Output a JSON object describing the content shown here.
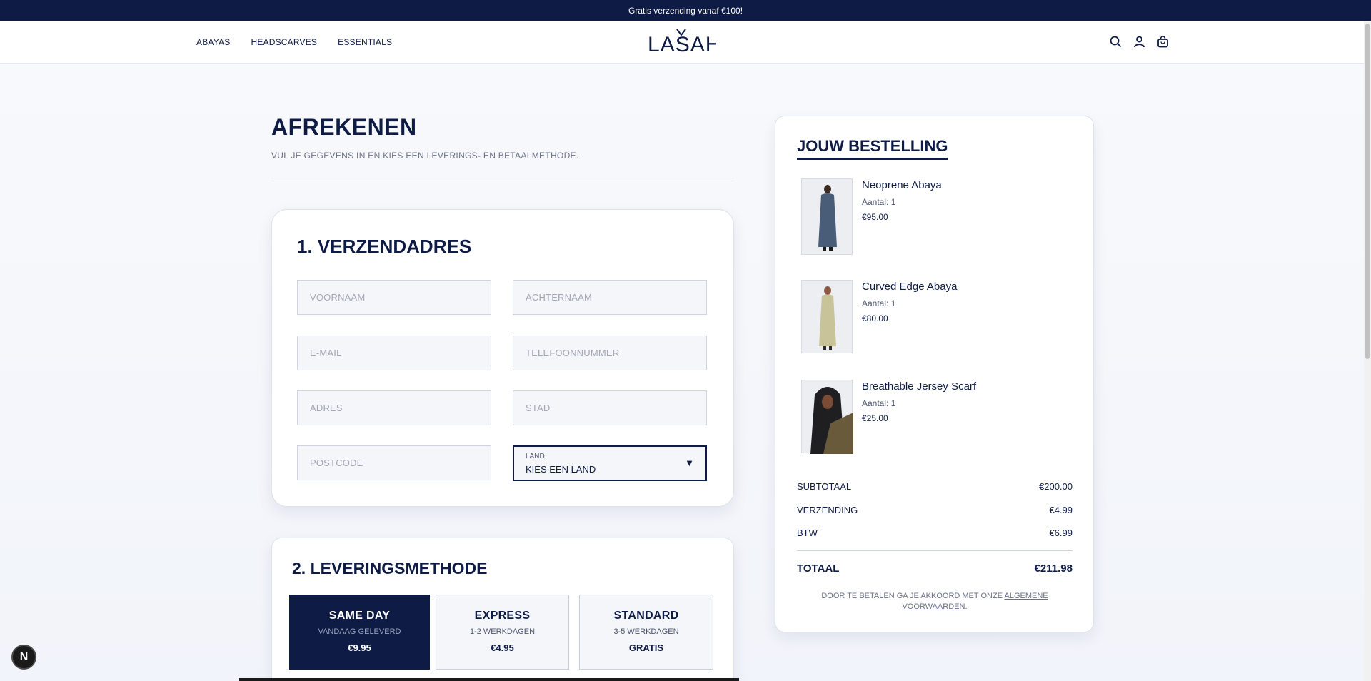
{
  "announcement": "Gratis verzending vanaf €100!",
  "nav": {
    "items": [
      "ABAYAS",
      "HEADSCARVES",
      "ESSENTIALS"
    ]
  },
  "brand": {
    "logo_text": "LASAH"
  },
  "header_icons": [
    "search-icon",
    "account-icon",
    "cart-icon"
  ],
  "checkout": {
    "title": "AFREKENEN",
    "subtitle": "VUL JE GEGEVENS IN EN KIES EEN LEVERINGS- EN BETAALMETHODE."
  },
  "address": {
    "title": "1. VERZENDADRES",
    "fields": {
      "first_name": "VOORNAAM",
      "last_name": "ACHTERNAAM",
      "email": "E-MAIL",
      "phone": "TELEFOONNUMMER",
      "address": "ADRES",
      "city": "STAD",
      "postcode": "POSTCODE"
    },
    "country": {
      "label": "LAND",
      "value": "KIES EEN LAND",
      "arrow": "▼"
    }
  },
  "delivery": {
    "title": "2. LEVERINGSMETHODE",
    "options": [
      {
        "name": "SAME DAY",
        "time": "VANDAAG GELEVERD",
        "price": "€9.95",
        "selected": true
      },
      {
        "name": "EXPRESS",
        "time": "1-2 WERKDAGEN",
        "price": "€4.95",
        "selected": false
      },
      {
        "name": "STANDARD",
        "time": "3-5 WERKDAGEN",
        "price": "GRATIS",
        "selected": false
      }
    ]
  },
  "summary": {
    "title": "JOUW BESTELLING",
    "items": [
      {
        "name": "Neoprene Abaya",
        "qty": "Aantal: 1",
        "price": "€95.00"
      },
      {
        "name": "Curved Edge Abaya",
        "qty": "Aantal: 1",
        "price": "€80.00"
      },
      {
        "name": "Breathable Jersey Scarf",
        "qty": "Aantal: 1",
        "price": "€25.00"
      }
    ],
    "subtotal_label": "SUBTOTAAL",
    "subtotal": "€200.00",
    "shipping_label": "VERZENDING",
    "shipping": "€4.99",
    "tax_label": "BTW",
    "tax": "€6.99",
    "total_label": "TOTAAL",
    "total": "€211.98",
    "terms_prefix": "DOOR TE BETALEN GA JE AKKOORD MET ONZE ",
    "terms_link": "ALGEMENE VOORWAARDEN",
    "terms_suffix": "."
  },
  "badge": "N",
  "colors": {
    "navy": "#0d1b45",
    "background": "#f4f6fb",
    "white": "#ffffff"
  }
}
